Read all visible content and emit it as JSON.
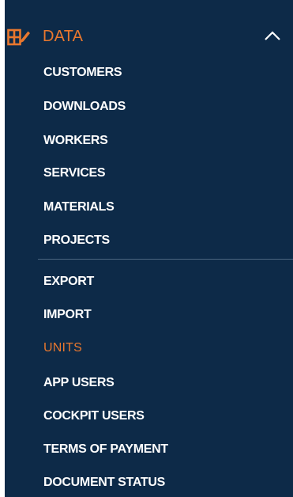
{
  "section": {
    "title": "DATA",
    "icon": "table-edit-icon",
    "expanded_icon": "chevron-up-icon",
    "accent_color": "#e8772e"
  },
  "menu": {
    "group1": [
      "CUSTOMERS",
      "DOWNLOADS",
      "WORKERS",
      "SERVICES",
      "MATERIALS",
      "PROJECTS"
    ],
    "group2": [
      "EXPORT",
      "IMPORT",
      "UNITS",
      "APP USERS",
      "COCKPIT USERS",
      "TERMS OF PAYMENT",
      "DOCUMENT STATUS"
    ],
    "active_item": "UNITS"
  },
  "colors": {
    "background": "#0d2a48",
    "text": "#ffffff",
    "active": "#e8772e",
    "divider": "#4c6680"
  }
}
